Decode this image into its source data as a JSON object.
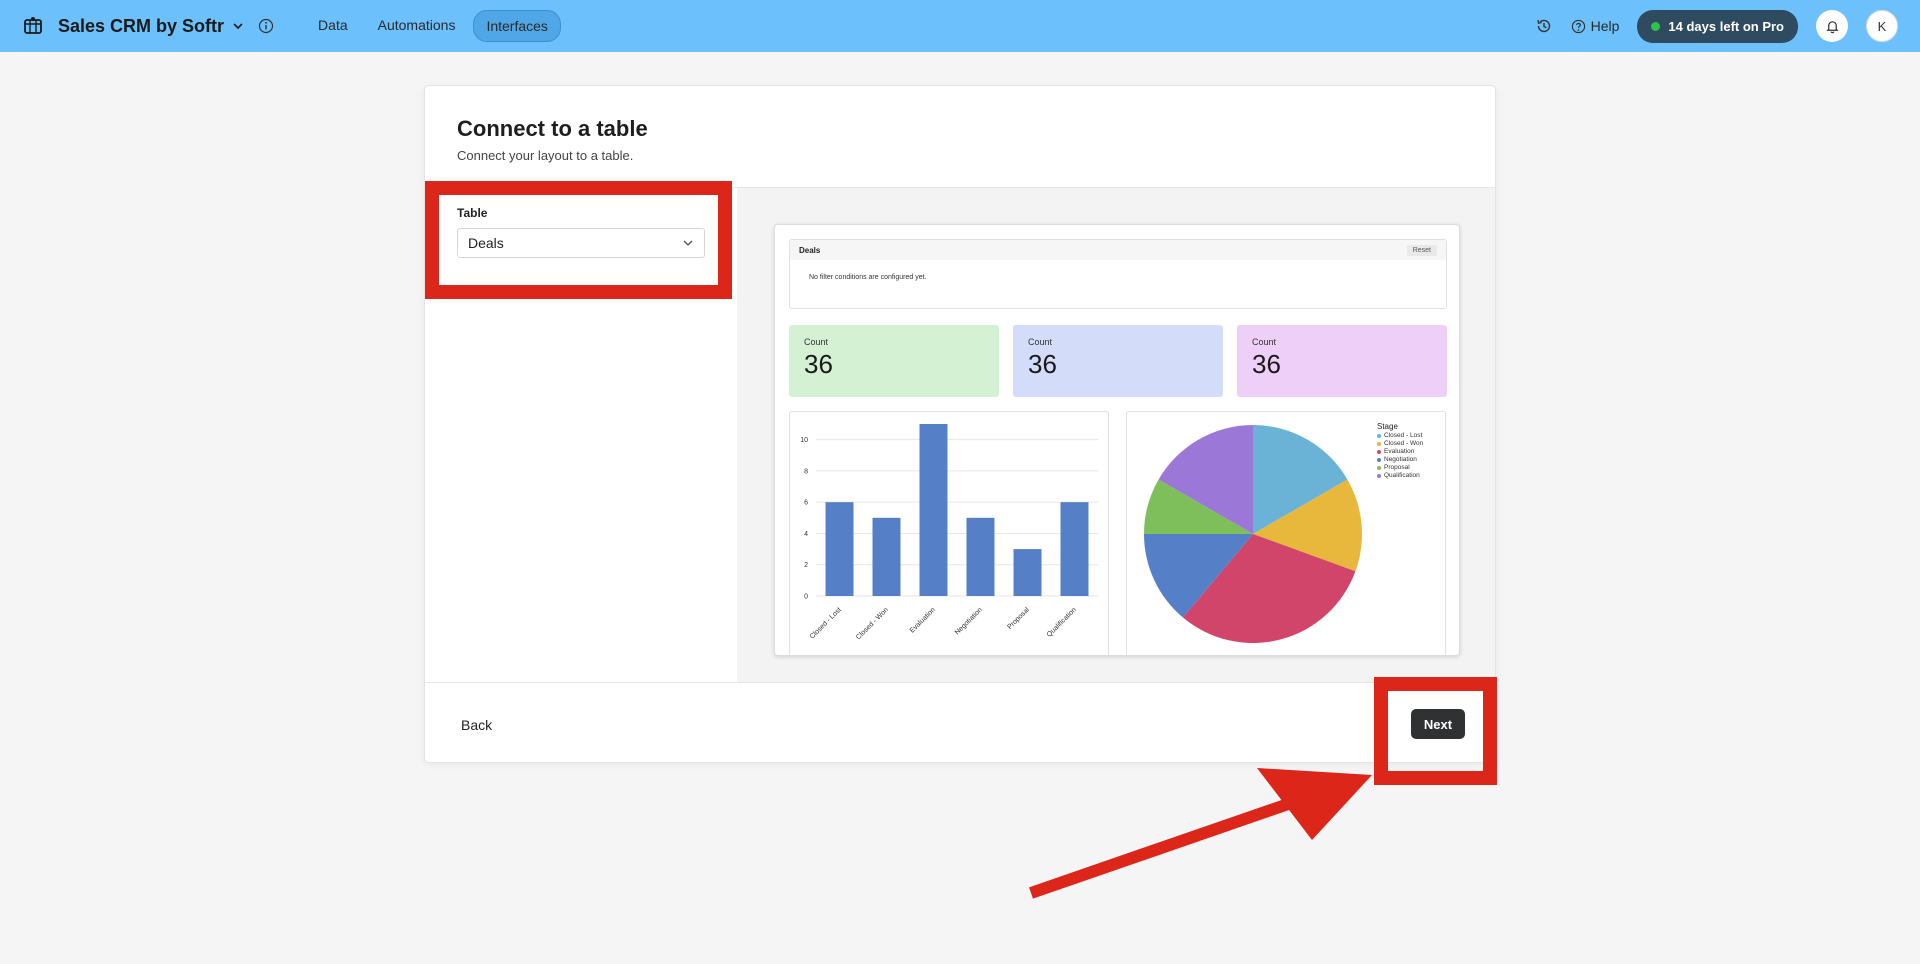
{
  "topbar": {
    "app_title": "Sales CRM by Softr",
    "nav": [
      {
        "label": "Data",
        "active": false
      },
      {
        "label": "Automations",
        "active": false
      },
      {
        "label": "Interfaces",
        "active": true
      }
    ],
    "help_label": "Help",
    "trial_label": "14 days left on Pro",
    "avatar_initial": "K",
    "icons": [
      "logo-icon",
      "chevron-down-icon",
      "info-icon",
      "history-icon",
      "help-icon",
      "bell-icon"
    ]
  },
  "modal": {
    "title": "Connect to a table",
    "subtitle": "Connect your layout to a table.",
    "table_field": {
      "label": "Table",
      "value": "Deals"
    },
    "back_label": "Back",
    "next_label": "Next"
  },
  "preview": {
    "filter": {
      "title": "Deals",
      "reset_label": "Reset",
      "message": "No filter conditions are configured yet."
    },
    "stats": [
      {
        "label": "Count",
        "value": "36",
        "color": "#d5f1d3"
      },
      {
        "label": "Count",
        "value": "36",
        "color": "#d3ddfa"
      },
      {
        "label": "Count",
        "value": "36",
        "color": "#eecff8"
      }
    ]
  },
  "chart_data": [
    {
      "type": "bar",
      "categories": [
        "Closed - Lost",
        "Closed - Won",
        "Evaluation",
        "Negotiation",
        "Proposal",
        "Qualification"
      ],
      "values": [
        6,
        5,
        11,
        5,
        3,
        6
      ],
      "ylim": [
        0,
        11
      ],
      "yticks": [
        "0",
        "2",
        "4",
        "6",
        "8",
        "10"
      ],
      "color": "#5580c8",
      "grid": true
    },
    {
      "type": "pie",
      "legend_title": "Stage",
      "labels": [
        "Closed - Lost",
        "Closed - Won",
        "Evaluation",
        "Negotiation",
        "Proposal",
        "Qualification"
      ],
      "values": [
        6,
        5,
        11,
        5,
        3,
        6
      ],
      "colors": [
        "#6ab3d6",
        "#e8b83c",
        "#d2456a",
        "#5580c8",
        "#7fbf5b",
        "#9b78d8"
      ],
      "legend_position": "top-right"
    }
  ],
  "annotations": {
    "color": "#db2619"
  }
}
